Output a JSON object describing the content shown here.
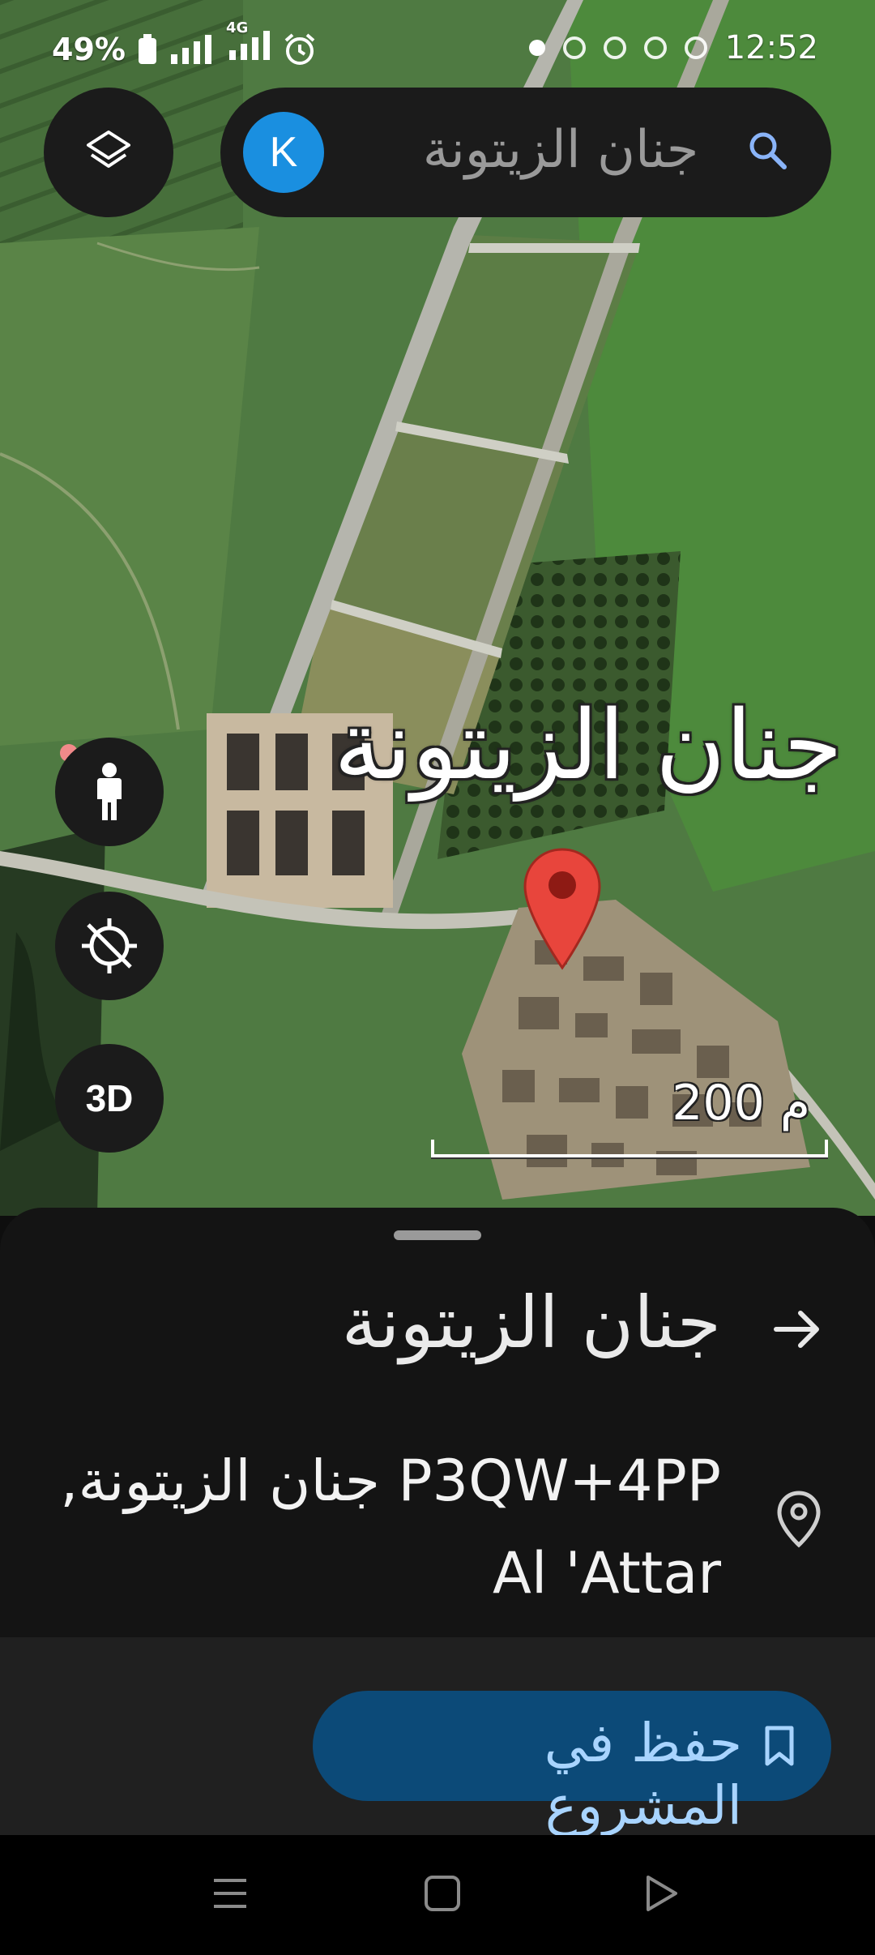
{
  "status_bar": {
    "battery": "49%",
    "network": "4G",
    "time": "12:52"
  },
  "search": {
    "avatar_letter": "K",
    "query": "جنان الزيتونة",
    "icon": "search-icon"
  },
  "map_controls": {
    "layers_icon": "layers-icon",
    "pegman_icon": "street-view-pegman-icon",
    "location_icon": "location-disabled-icon",
    "view_3d_label": "3D"
  },
  "map": {
    "place_label": "جنان الزيتونة",
    "scale_label": "200 م",
    "marker_icon": "red-map-pin-icon"
  },
  "sheet": {
    "title": "جنان الزيتونة",
    "direction_icon": "arrow-right-icon",
    "address_line1": "P3QW+4PP جنان الزيتونة,",
    "address_line2": "Al 'Attar",
    "address_icon": "location-pin-outline-icon",
    "save_button_label": "حفظ في المشروع",
    "save_icon": "bookmark-icon"
  },
  "nav_bar": {
    "recents_icon": "menu-lines-icon",
    "home_icon": "square-icon",
    "back_icon": "triangle-back-icon"
  },
  "colors": {
    "accent_blue": "#1a8fe0",
    "save_button_bg": "#0c4a78",
    "save_button_text": "#a8d4ff",
    "marker_red": "#e8453c"
  }
}
